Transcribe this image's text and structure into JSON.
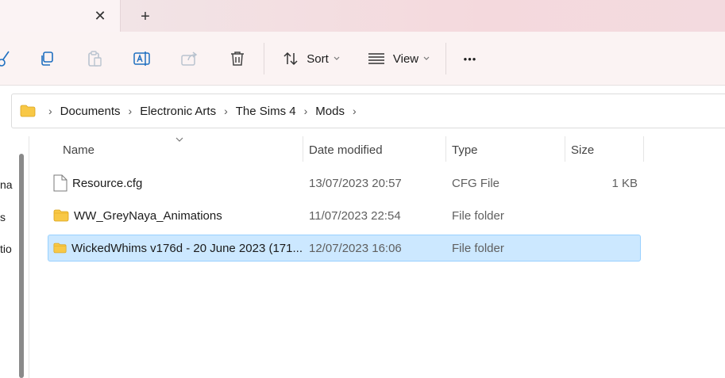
{
  "tabbar": {
    "close_glyph": "✕",
    "new_tab_glyph": "+"
  },
  "toolbar": {
    "sort_label": "Sort",
    "view_label": "View",
    "more_glyph": "•••"
  },
  "breadcrumb": [
    "Documents",
    "Electronic Arts",
    "The Sims 4",
    "Mods"
  ],
  "nav": {
    "items": [
      "na",
      "s",
      "tio"
    ]
  },
  "columns": {
    "name": "Name",
    "date": "Date modified",
    "type": "Type",
    "size": "Size"
  },
  "files": [
    {
      "name": "Resource.cfg",
      "date": "13/07/2023 20:57",
      "type": "CFG File",
      "size": "1 KB",
      "icon": "file-icon"
    },
    {
      "name": "WW_GreyNaya_Animations",
      "date": "11/07/2023 22:54",
      "type": "File folder",
      "size": "",
      "icon": "folder-icon"
    },
    {
      "name": "WickedWhims v176d - 20 June 2023 (171...",
      "date": "12/07/2023 16:06",
      "type": "File folder",
      "size": "",
      "icon": "folder-icon",
      "selected": true
    }
  ],
  "colors": {
    "selection_bg": "#cce8ff",
    "selection_border": "#99d1ff",
    "folder_yellow": "#f8c846"
  }
}
